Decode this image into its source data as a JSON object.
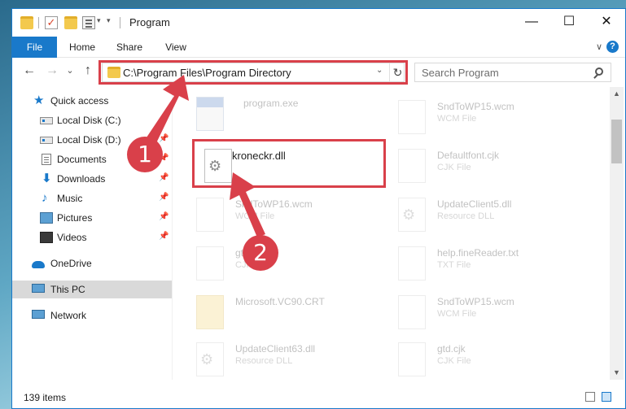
{
  "window": {
    "title": "Program",
    "minimize": "—",
    "maximize": "☐",
    "close": "✕"
  },
  "ribbon": {
    "tabs": [
      "File",
      "Home",
      "Share",
      "View"
    ],
    "expand": "∨",
    "help": "?"
  },
  "nav": {
    "back": "←",
    "forward": "→",
    "recent": "⌄",
    "up": "↑",
    "address": "C:\\Program Files\\Program Directory",
    "dropdown": "⌄",
    "refresh": "↻",
    "search_placeholder": "Search Program"
  },
  "sidebar": {
    "items": [
      {
        "label": "Quick access",
        "icon": "star-icon"
      },
      {
        "label": "Local Disk (C:)",
        "icon": "disk-icon"
      },
      {
        "label": "Local Disk (D:)",
        "icon": "disk-icon"
      },
      {
        "label": "Documents",
        "icon": "documents-icon"
      },
      {
        "label": "Downloads",
        "icon": "downloads-icon"
      },
      {
        "label": "Music",
        "icon": "music-icon"
      },
      {
        "label": "Pictures",
        "icon": "pictures-icon"
      },
      {
        "label": "Videos",
        "icon": "videos-icon"
      },
      {
        "label": "OneDrive",
        "icon": "cloud-icon"
      },
      {
        "label": "This PC",
        "icon": "computer-icon"
      },
      {
        "label": "Network",
        "icon": "network-icon"
      }
    ],
    "pin": "📌"
  },
  "files": {
    "left": [
      {
        "name": "program.exe",
        "type": ""
      },
      {
        "name": "kroneckr.dll",
        "type": ""
      },
      {
        "name": "SndToWP16.wcm",
        "type": "WCM File"
      },
      {
        "name": "gtd.",
        "type": "CJK"
      },
      {
        "name": "Microsoft.VC90.CRT",
        "type": ""
      },
      {
        "name": "UpdateClient63.dll",
        "type": "Resource DLL"
      }
    ],
    "right": [
      {
        "name": "SndToWP15.wcm",
        "type": "WCM File"
      },
      {
        "name": "Defaultfont.cjk",
        "type": "CJK File"
      },
      {
        "name": "UpdateClient5.dll",
        "type": "Resource DLL"
      },
      {
        "name": "help.fineReader.txt",
        "type": "TXT File"
      },
      {
        "name": "SndToWP15.wcm",
        "type": "WCM File"
      },
      {
        "name": "gtd.cjk",
        "type": "CJK File"
      }
    ]
  },
  "callouts": {
    "one": "1",
    "two": "2"
  },
  "status": {
    "items": "139 items"
  },
  "scroll": {
    "up": "▲",
    "down": "▼"
  },
  "colors": {
    "accent": "#1979ca",
    "highlight": "#d9404a"
  }
}
